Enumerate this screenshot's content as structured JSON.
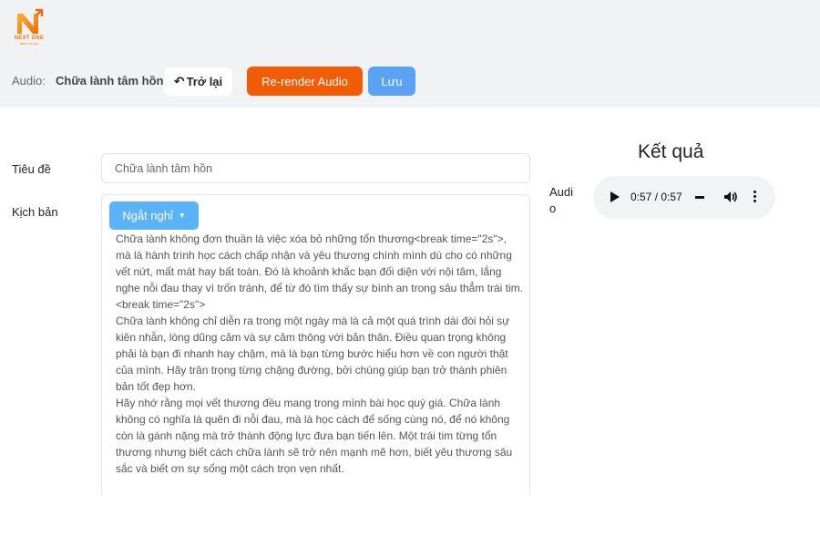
{
  "logo": {
    "text": "NEXT ONE",
    "subtext": "BEST OF ONE"
  },
  "header": {
    "audio_label": "Audio:",
    "audio_name": "Chữa lành tâm hồn",
    "back_label": "Trở lại",
    "rerender_label": "Re-render Audio",
    "save_label": "Lưu"
  },
  "form": {
    "title_label": "Tiêu đề",
    "title_value": "Chữa lành tâm hồn",
    "script_label": "Kịch bản",
    "pause_label": "Ngắt nghỉ",
    "script_text": "Chữa lành không đơn thuần là việc xóa bỏ những tổn thương<break time=\"2s\">, mà là hành trình học cách chấp nhận và yêu thương chính mình dù cho có những vết nứt, mất mát hay bất toàn. Đó là khoảnh khắc bạn đối diện với nội tâm, lắng nghe nỗi đau thay vì trốn tránh, để từ đó tìm thấy sự bình an trong sâu thẳm trái tim. <break time=\"2s\">\nChữa lành không chỉ diễn ra trong một ngày mà là cả một quá trình dài đòi hỏi sự kiên nhẫn, lòng dũng cảm và sự cảm thông với bản thân. Điều quan trọng không phải là bạn đi nhanh hay chậm, mà là bạn từng bước hiểu hơn về con người thật của mình. Hãy trân trọng từng chặng đường, bởi chúng giúp bạn trở thành phiên bản tốt đẹp hơn.\nHãy nhớ rằng mọi vết thương đều mang trong mình bài học quý giá. Chữa lành không có nghĩa là quên đi nỗi đau, mà là học cách để sống cùng nó, để nó không còn là gánh nặng mà trở thành động lực đưa bạn tiến lên. Một trái tim từng tổn thương nhưng biết cách chữa lành sẽ trở nên mạnh mẽ hơn, biết yêu thương sâu sắc và biết ơn sự sống một cách trọn vẹn nhất."
  },
  "result": {
    "title": "Kết quả",
    "audio_label": "Audio",
    "player": {
      "time": "0:57 / 0:57",
      "progress": 1.0
    }
  },
  "icons": {
    "back": "undo-arrow-icon",
    "caret": "caret-down-icon",
    "play": "play-icon",
    "volume": "volume-icon",
    "more": "more-vertical-icon"
  },
  "colors": {
    "rerender": "#f25c05",
    "save": "#5aa2f5",
    "pause": "#5ab3f6",
    "brand": "#f07a10"
  }
}
